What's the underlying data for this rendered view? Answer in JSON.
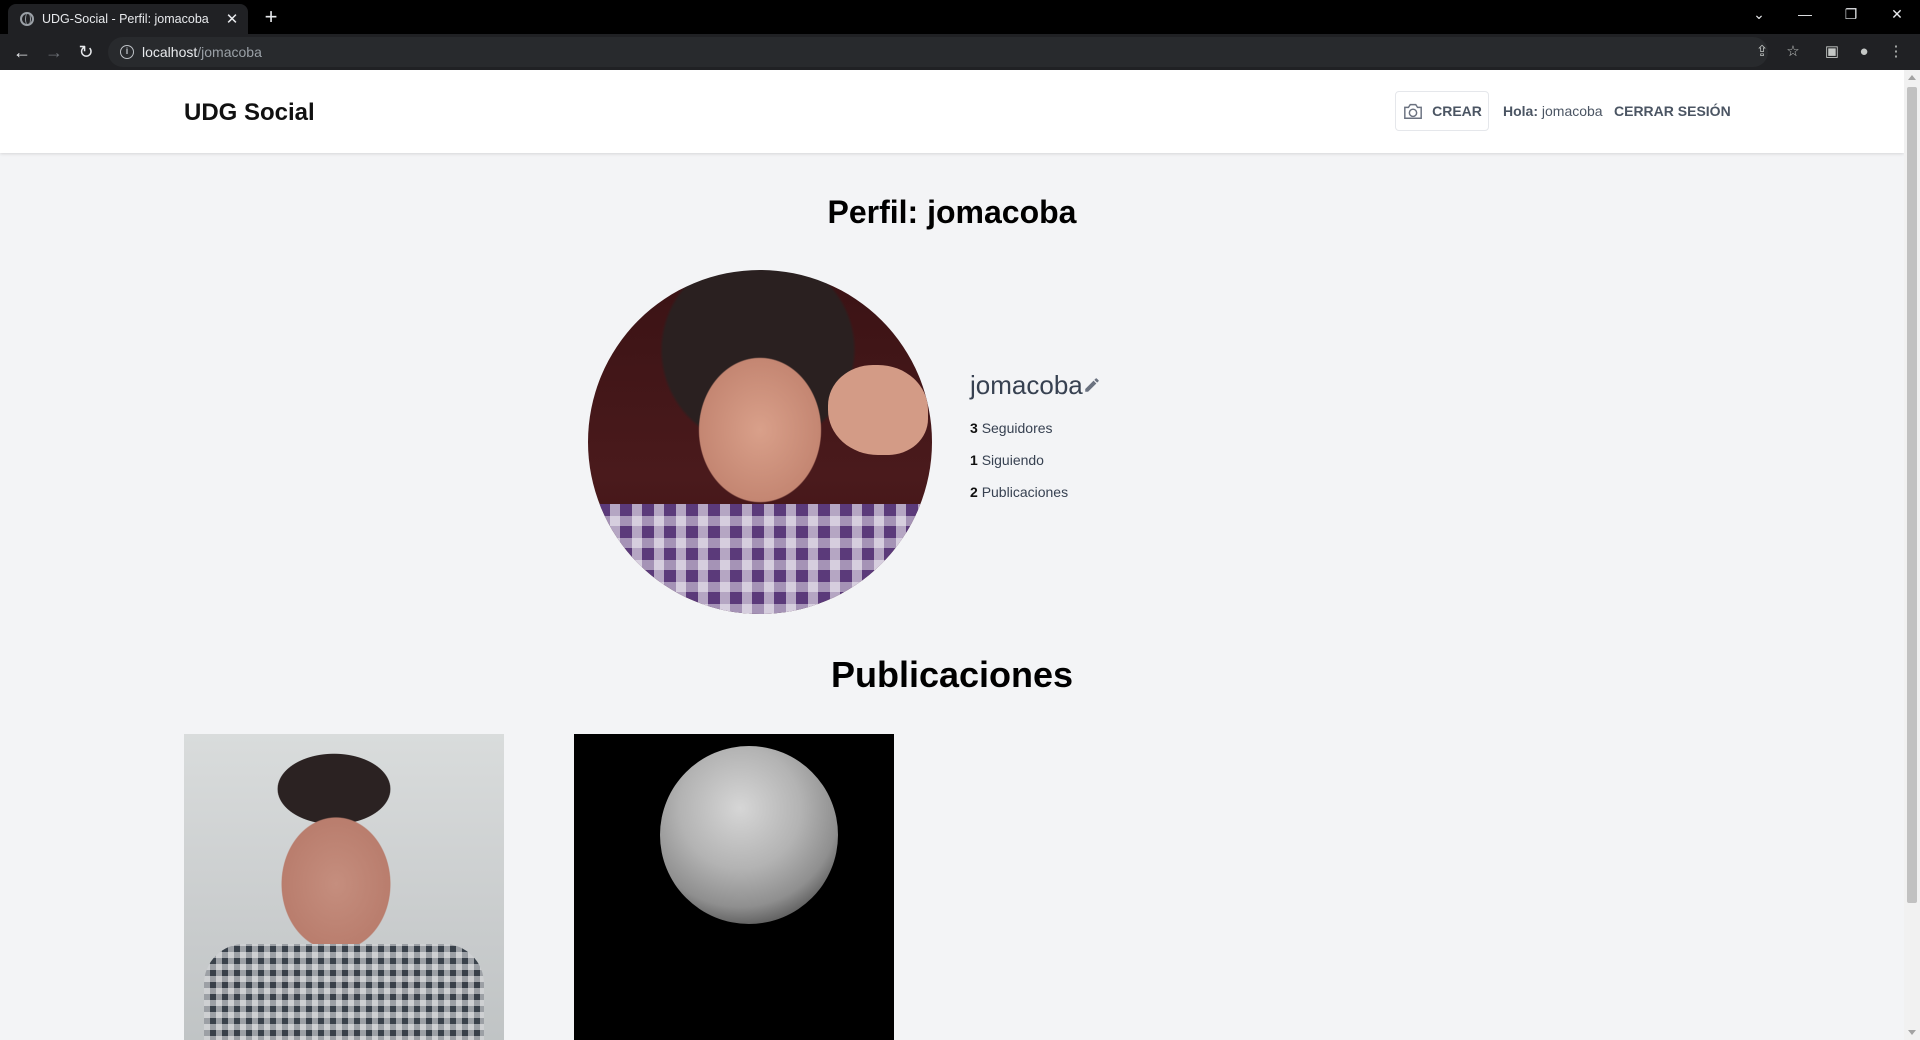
{
  "browser": {
    "tab_title": "UDG-Social - Perfil: jomacoba",
    "url_host": "localhost",
    "url_path": "/jomacoba"
  },
  "header": {
    "brand": "UDG Social",
    "create_label": "CREAR",
    "greeting_prefix": "Hola:",
    "greeting_user": "jomacoba",
    "logout_label": "CERRAR SESIÓN"
  },
  "profile": {
    "title": "Perfil: jomacoba",
    "username": "jomacoba",
    "stats": {
      "followers_count": "3",
      "followers_label": "Seguidores",
      "following_count": "1",
      "following_label": "Siguiendo",
      "posts_count": "2",
      "posts_label": "Publicaciones"
    }
  },
  "posts": {
    "title": "Publicaciones"
  },
  "icons": {
    "tab_favicon": "globe-icon",
    "create": "camera-icon",
    "edit_username": "pencil-icon"
  },
  "colors": {
    "page_background": "#f3f4f6",
    "header_background": "#ffffff",
    "text_muted": "#4b5563"
  }
}
